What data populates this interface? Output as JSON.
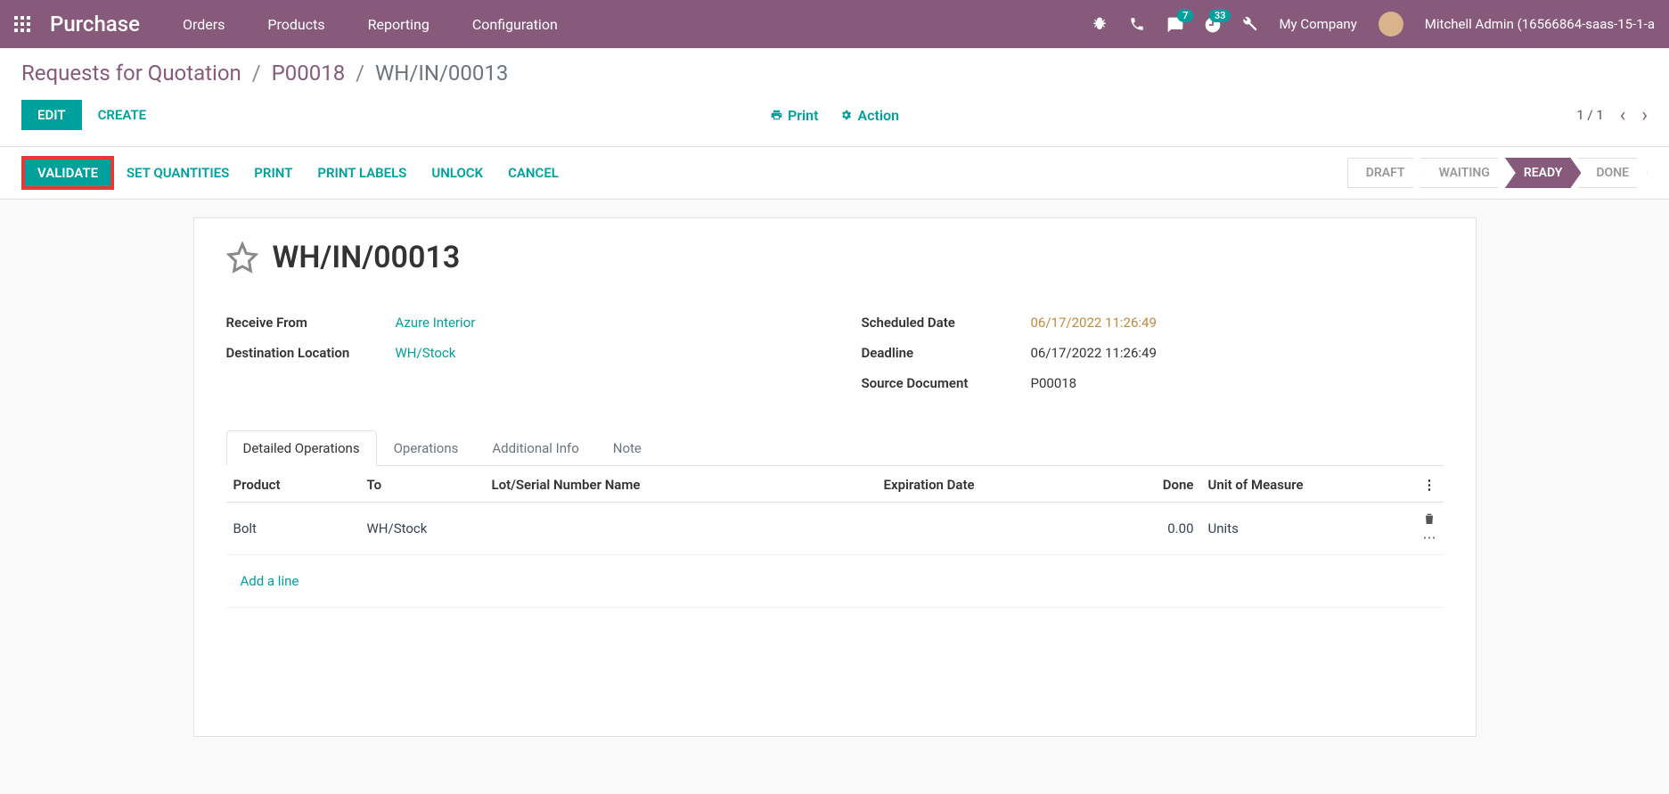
{
  "navbar": {
    "brand": "Purchase",
    "links": [
      "Orders",
      "Products",
      "Reporting",
      "Configuration"
    ],
    "msg_badge": "7",
    "activity_badge": "33",
    "company": "My Company",
    "user": "Mitchell Admin (16566864-saas-15-1-a"
  },
  "breadcrumb": {
    "root": "Requests for Quotation",
    "parent": "P00018",
    "current": "WH/IN/00013"
  },
  "actions": {
    "edit": "EDIT",
    "create": "CREATE",
    "print": "Print",
    "action": "Action",
    "pager": "1 / 1"
  },
  "statusbar": {
    "validate": "VALIDATE",
    "set_qty": "SET QUANTITIES",
    "print": "PRINT",
    "print_labels": "PRINT LABELS",
    "unlock": "UNLOCK",
    "cancel": "CANCEL",
    "steps": [
      "DRAFT",
      "WAITING",
      "READY",
      "DONE"
    ],
    "active_step": 2
  },
  "doc": {
    "title": "WH/IN/00013",
    "fields": {
      "receive_from_label": "Receive From",
      "receive_from_value": "Azure Interior",
      "dest_label": "Destination Location",
      "dest_value": "WH/Stock",
      "sched_label": "Scheduled Date",
      "sched_value": "06/17/2022 11:26:49",
      "deadline_label": "Deadline",
      "deadline_value": "06/17/2022 11:26:49",
      "source_label": "Source Document",
      "source_value": "P00018"
    }
  },
  "tabs": [
    "Detailed Operations",
    "Operations",
    "Additional Info",
    "Note"
  ],
  "table": {
    "headers": {
      "product": "Product",
      "to": "To",
      "lot": "Lot/Serial Number Name",
      "exp": "Expiration Date",
      "done": "Done",
      "uom": "Unit of Measure"
    },
    "rows": [
      {
        "product": "Bolt",
        "to": "WH/Stock",
        "lot": "",
        "exp": "",
        "done": "0.00",
        "uom": "Units"
      }
    ],
    "add_line": "Add a line"
  }
}
